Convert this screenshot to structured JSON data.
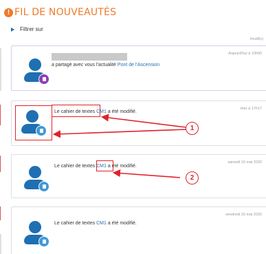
{
  "header": {
    "icon": "!",
    "title": "FIL DE NOUVEAUTÉS"
  },
  "filter": {
    "label": "Filtrer sur"
  },
  "modif_label": "/modif(s)",
  "cards": [
    {
      "date": "Aujourd'hui à 10h00",
      "text_prefix": "a partagé avec vous l'actualité ",
      "link": "Pont de l'Ascension",
      "text_suffix": "",
      "badge_icon": "calendar-icon"
    },
    {
      "date": "Hier à 17h17",
      "text_prefix": "Le cahier de textes ",
      "link": "CM1",
      "text_suffix": " a été modifié.",
      "badge_icon": "notebook-icon"
    },
    {
      "date": "samedi 16 mai 2020",
      "text_prefix": "Le cahier de textes ",
      "link": "CM1",
      "text_suffix": " a été modifié.",
      "badge_icon": "notebook-icon"
    },
    {
      "date": "vendredi 15 mai 2020",
      "text_prefix": "Le cahier de textes ",
      "link": "CM1",
      "text_suffix": " a été modifié.",
      "badge_icon": "notebook-icon"
    }
  ],
  "annotations": {
    "callout_1": "1",
    "callout_2": "2"
  },
  "colors": {
    "accent": "#f07a2a",
    "link": "#1f6fb3",
    "annotation": "#e0232a",
    "badge_blue": "#3f9ad8",
    "badge_purple": "#8e3fb8"
  }
}
